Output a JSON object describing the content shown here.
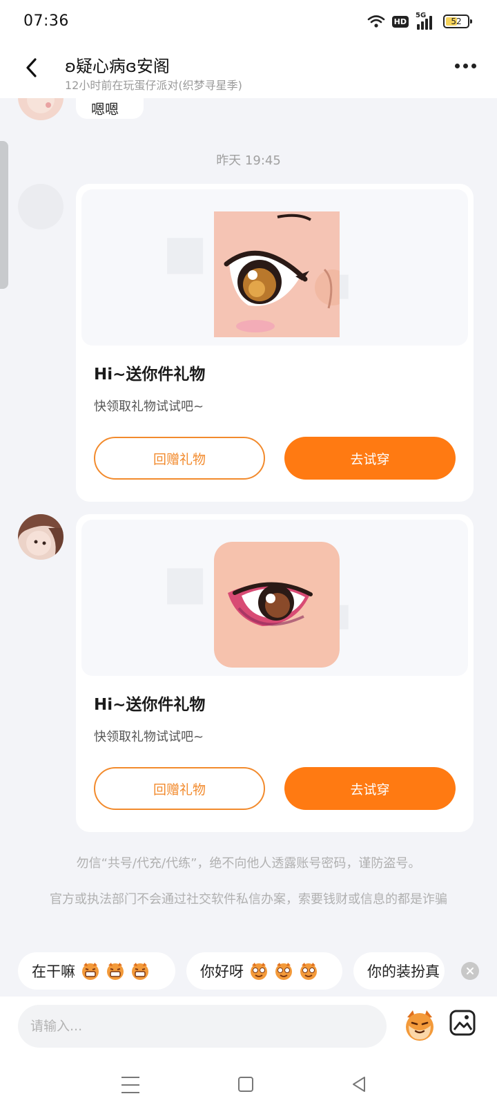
{
  "status_bar": {
    "time": "07:36",
    "signal_label": "5G",
    "hd_label": "HD",
    "battery": "52",
    "battery_level": 0.52
  },
  "header": {
    "title": "ʚ疑心病ɞ安阁",
    "subtitle": "12小时前在玩蛋仔派对(织梦寻星季)",
    "back_icon": "chevron-left-icon",
    "more_icon": "more-dots-icon"
  },
  "chat": {
    "previous_message": "嗯嗯",
    "timestamp": "昨天 19:45",
    "gift_cards": [
      {
        "title": "Hi~送你件礼物",
        "description": "快领取礼物试试吧~",
        "return_button": "回赠礼物",
        "try_button": "去试穿",
        "item_icon": "anime-eye-gold"
      },
      {
        "title": "Hi~送你件礼物",
        "description": "快领取礼物试试吧~",
        "return_button": "回赠礼物",
        "try_button": "去试穿",
        "item_icon": "anime-eye-pink"
      }
    ],
    "notices": [
      "勿信“共号/代充/代练”，绝不向他人透露账号密码，谨防盗号。",
      "官方或执法部门不会通过社交软件私信办案，索要钱财或信息的都是诈骗"
    ]
  },
  "quick_replies": [
    {
      "text": "在干嘛",
      "emoji": "grin-face-icon"
    },
    {
      "text": "你好呀",
      "emoji": "wink-face-icon"
    },
    {
      "text": "你的装扮真",
      "emoji": ""
    }
  ],
  "input": {
    "placeholder": "请输入...",
    "value": ""
  },
  "colors": {
    "accent": "#ff7a12",
    "accent_outline": "#f28a2c",
    "background": "#f3f4f8"
  }
}
